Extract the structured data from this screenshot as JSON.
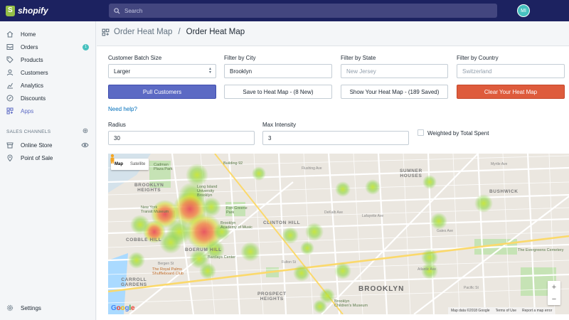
{
  "app": {
    "brand": "shopify",
    "user_initials": "MI"
  },
  "search": {
    "placeholder": "Search"
  },
  "sidebar": {
    "items": [
      {
        "label": "Home",
        "icon": "home-icon"
      },
      {
        "label": "Orders",
        "icon": "orders-icon",
        "badge": "1"
      },
      {
        "label": "Products",
        "icon": "tag-icon"
      },
      {
        "label": "Customers",
        "icon": "person-icon"
      },
      {
        "label": "Analytics",
        "icon": "chart-icon"
      },
      {
        "label": "Discounts",
        "icon": "discount-icon"
      },
      {
        "label": "Apps",
        "icon": "apps-icon"
      }
    ],
    "channels_label": "SALES CHANNELS",
    "channels": [
      {
        "label": "Online Store",
        "icon": "store-icon"
      },
      {
        "label": "Point of Sale",
        "icon": "location-pin-icon"
      }
    ],
    "settings_label": "Settings"
  },
  "breadcrumb": {
    "parent": "Order Heat Map",
    "separator": "/",
    "current": "Order Heat Map"
  },
  "filters": {
    "batch_label": "Customer Batch Size",
    "batch_value": "Larger",
    "city_label": "Filter by City",
    "city_value": "Brooklyn",
    "state_label": "Filter by State",
    "state_placeholder": "New Jersey",
    "country_label": "Filter by Country",
    "country_placeholder": "Switzerland"
  },
  "buttons": {
    "pull": "Pull Customers",
    "save": "Save to Heat Map - (8 New)",
    "show": "Show Your Heat Map - (189 Saved)",
    "clear": "Clear Your Heat Map"
  },
  "help_link": "Need help?",
  "radius": {
    "label": "Radius",
    "value": "30"
  },
  "intensity": {
    "label": "Max Intensity",
    "value": "3"
  },
  "weighted_label": "Weighted by Total Spent",
  "map": {
    "toggle_map": "Map",
    "toggle_satellite": "Satellite",
    "labels": {
      "cadman": "Cadman\nPlaza Park",
      "brooklyn_heights": "BROOKLYN\nHEIGHTS",
      "building92": "Building 92",
      "summer_houses": "SUMNER\nHOUSES",
      "bushwick": "BUSHWICK",
      "ny_transit": "New York\nTransit Museum",
      "fort_greene": "Fort Greene\nPark",
      "clinton_hill": "CLINTON HILL",
      "academy": "Brooklyn\nAcademy of Music",
      "cobble_hill": "COBBLE HILL",
      "boerum_hill": "BOERUM HILL",
      "barclays": "Barclays Center",
      "evergreens": "The Evergreens Cemetery",
      "royal_palms": "The Royal Palms\nShuffleboard Club",
      "carroll_gardens": "CARROLL\nGARDENS",
      "prospect_heights": "PROSPECT\nHEIGHTS",
      "brooklyn": "BROOKLYN",
      "childrens_museum": "Brooklyn\nChildren's Museum",
      "liu": "Long Island\nUniversity\nBrooklyn"
    },
    "streets": [
      "Flushing Ave",
      "Myrtle Ave",
      "DeKalb Ave",
      "Lafayette Ave",
      "Atlantic Ave",
      "Fulton St",
      "Gates Ave",
      "Pacific St",
      "Bergen St"
    ],
    "google_logo": "Google",
    "attribution": [
      "Map data ©2018 Google",
      "Terms of Use",
      "Report a map error"
    ]
  },
  "colors": {
    "accent": "#5c6ac4",
    "danger": "#de5b3c",
    "topbar": "#1c2260",
    "badge": "#47c1bf"
  }
}
